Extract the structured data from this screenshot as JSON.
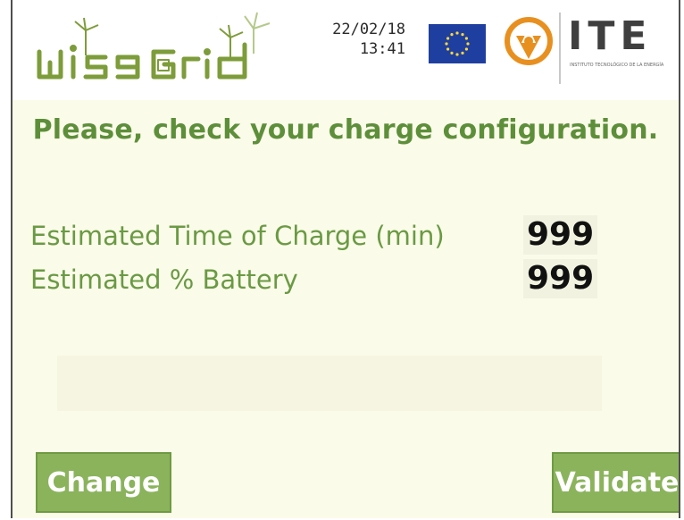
{
  "header": {
    "brand_name": "wiseGrid",
    "date": "22/02/18",
    "time": "13:41",
    "eu_flag_icon": "eu-flag-icon",
    "partner_name": "ITE",
    "partner_subtitle": "INSTITUTO TECNOLÓGICO DE LA ENERGÍA"
  },
  "main": {
    "heading": "Please, check your charge configuration.",
    "rows": [
      {
        "label": "Estimated Time of Charge (min)",
        "value": "999"
      },
      {
        "label": "Estimated % Battery",
        "value": "999"
      }
    ]
  },
  "buttons": {
    "change_label": "Change",
    "validate_label": "Validate"
  },
  "colors": {
    "accent_green": "#5d8f3a",
    "button_green": "#8bb35c",
    "background": "#fbfbe9",
    "ite_orange": "#e8901f",
    "eu_blue": "#1f3fa0",
    "eu_star": "#ffd93a"
  }
}
